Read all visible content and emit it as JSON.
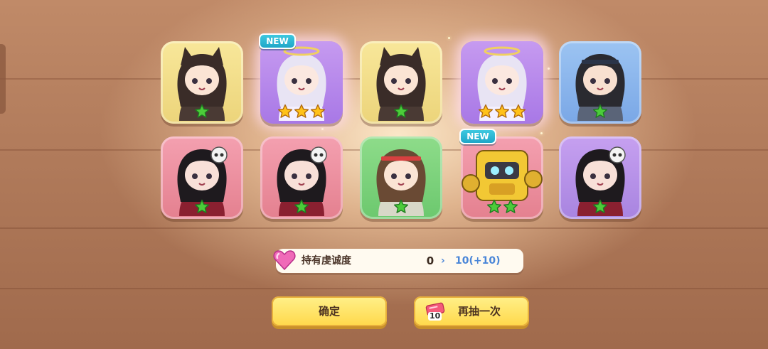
{
  "colors": {
    "card_yellow": "#f8e79a",
    "card_purple": "#c69af0",
    "card_blue": "#9cc4f2",
    "card_pink": "#f4a0b0",
    "card_green": "#8edc8a",
    "new_badge": "#1fa6c8",
    "button": "#ffd84a",
    "accent_blue": "#4a86d8"
  },
  "results": [
    {
      "frame": "yellow",
      "character": "wolf-ear-girl-with-teacup",
      "stars": 1,
      "is_new": false
    },
    {
      "frame": "purple",
      "character": "silver-haired-girl-with-staff",
      "stars": 3,
      "is_new": true,
      "new_label": "NEW"
    },
    {
      "frame": "yellow",
      "character": "wolf-ear-girl-with-teacup",
      "stars": 1,
      "is_new": false
    },
    {
      "frame": "purple",
      "character": "silver-haired-girl-with-staff",
      "stars": 3,
      "is_new": false
    },
    {
      "frame": "blue",
      "character": "dark-haired-girl-with-bowl",
      "stars": 1,
      "is_new": false
    },
    {
      "frame": "pink",
      "character": "black-haired-girl-with-skull",
      "stars": 1,
      "is_new": false
    },
    {
      "frame": "pink",
      "character": "black-haired-girl-with-skull",
      "stars": 1,
      "is_new": false
    },
    {
      "frame": "green",
      "character": "brown-haired-girl-with-headband",
      "stars": 1,
      "is_new": false
    },
    {
      "frame": "pink",
      "character": "yellow-robot",
      "stars": 2,
      "is_new": true,
      "new_label": "NEW"
    },
    {
      "frame": "violet",
      "character": "black-haired-girl-with-skull",
      "stars": 1,
      "is_new": false
    }
  ],
  "loyalty": {
    "icon": "heart-gem-icon",
    "label": "持有虔诚度",
    "current": "0",
    "arrow": "›",
    "next": "10(+10)"
  },
  "buttons": {
    "confirm_label": "确定",
    "draw_again_label": "再抽一次",
    "ticket_icon": "ticket-icon",
    "ticket_count": "10"
  }
}
